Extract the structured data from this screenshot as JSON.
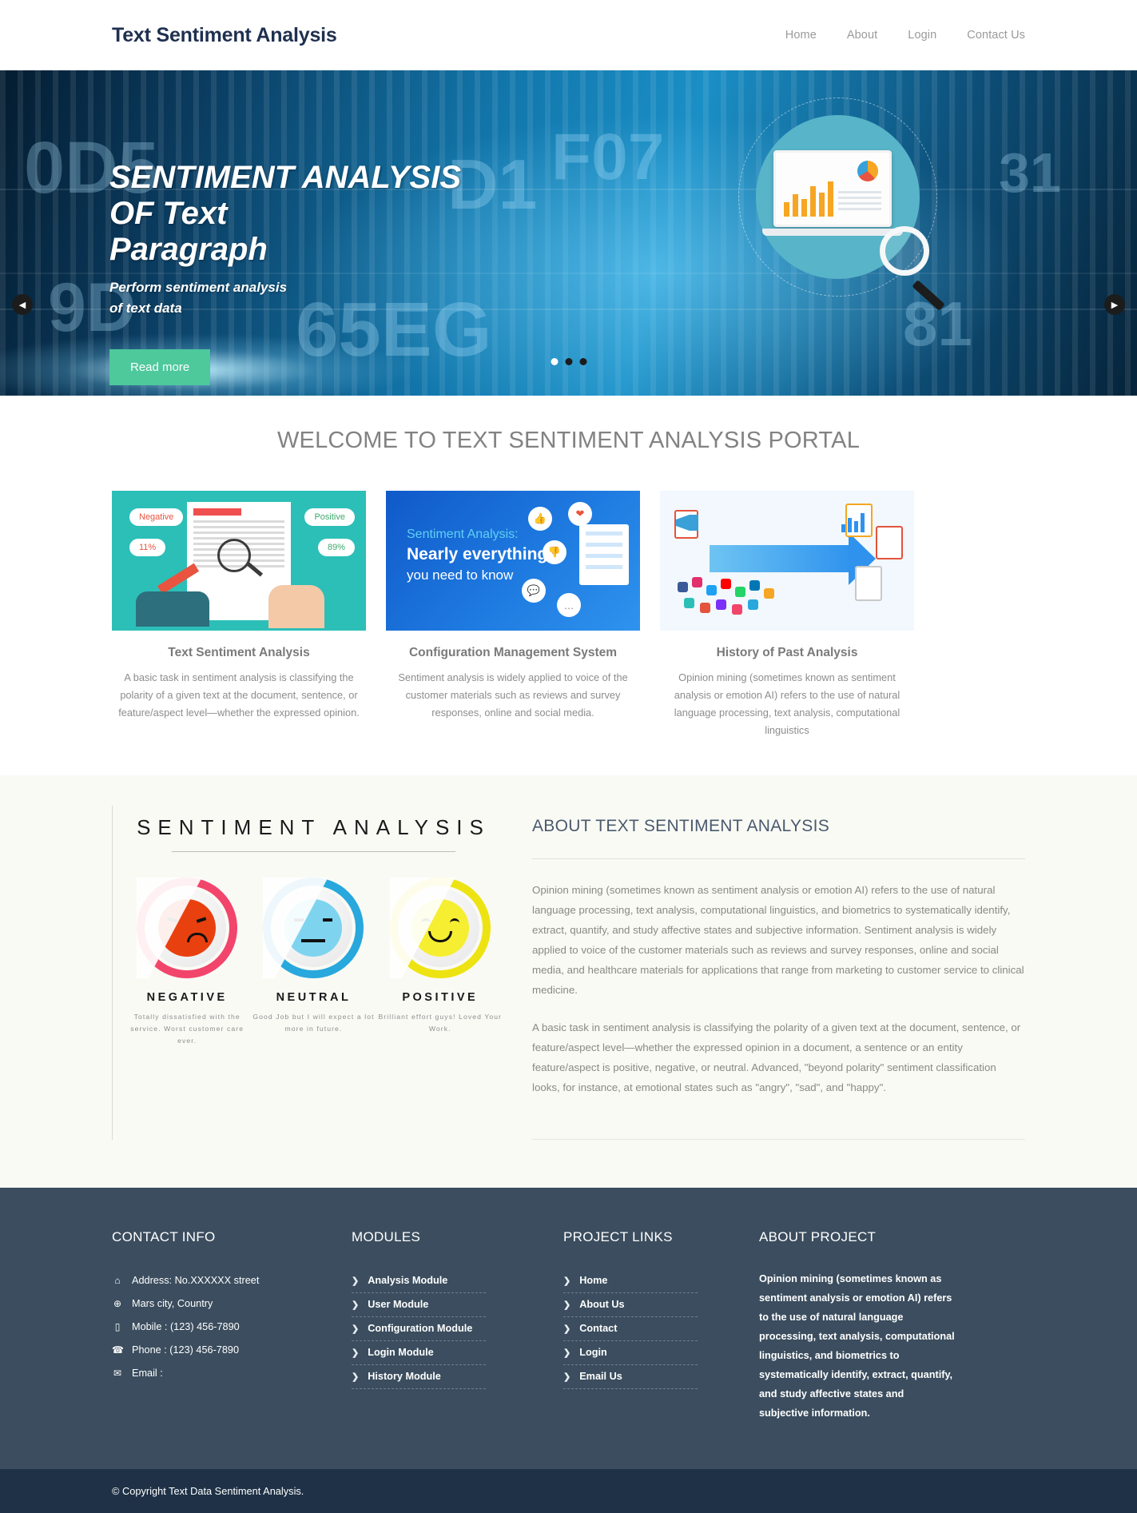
{
  "header": {
    "brand": "Text Sentiment Analysis",
    "nav": [
      {
        "label": "Home"
      },
      {
        "label": "About"
      },
      {
        "label": "Login"
      },
      {
        "label": "Contact Us"
      }
    ]
  },
  "hero": {
    "title_line1": "SENTIMENT ANALYSIS",
    "title_line2": "OF Text",
    "title_line3": "Paragraph",
    "subtitle_line1": "Perform sentiment analysis",
    "subtitle_line2": "of text data",
    "button": "Read more",
    "prev_icon": "chevron-left-icon",
    "next_icon": "chevron-right-icon",
    "dots": 3,
    "active_dot": 1,
    "bg_digits": [
      "0D5",
      "D1",
      "F07",
      "65EG",
      "81",
      "31",
      "9D"
    ],
    "accent": "#4dc99c"
  },
  "welcome": {
    "title": "WELCOME TO TEXT SENTIMENT ANALYSIS PORTAL",
    "cards": [
      {
        "title": "Text Sentiment Analysis",
        "desc": "A basic task in sentiment analysis is classifying the polarity of a given text at the document, sentence, or feature/aspect level—whether the expressed opinion.",
        "art_labels": {
          "negative": "Negative",
          "positive": "Positive",
          "neg_pct": "11%",
          "pos_pct": "89%"
        }
      },
      {
        "title": "Configuration Management System",
        "desc": "Sentiment analysis is widely applied to voice of the customer materials such as reviews and survey responses, online and social media.",
        "art_labels": {
          "line1": "Sentiment Analysis:",
          "line2": "Nearly everything",
          "line3": "you need to know"
        }
      },
      {
        "title": "History of Past Analysis",
        "desc": "Opinion mining (sometimes known as sentiment analysis or emotion AI) refers to the use of natural language processing, text analysis, computational linguistics",
        "art_labels": {}
      }
    ]
  },
  "about": {
    "graphic": {
      "title": "SENTIMENT ANALYSIS",
      "columns": [
        {
          "label": "NEGATIVE",
          "note": "Totally dissatisfied with the service. Worst customer care ever.",
          "ring_color": "#f2456b",
          "face_color": "#e8400f"
        },
        {
          "label": "NEUTRAL",
          "note": "Good Job but I will expect a lot more in future.",
          "ring_color": "#28a8dd",
          "face_color": "#7ed4ef"
        },
        {
          "label": "POSITIVE",
          "note": "Brilliant effort guys! Loved Your Work.",
          "ring_color": "#eee312",
          "face_color": "#f6ee31"
        }
      ]
    },
    "heading": "ABOUT TEXT SENTIMENT ANALYSIS",
    "paragraph1": "Opinion mining (sometimes known as sentiment analysis or emotion AI) refers to the use of natural language processing, text analysis, computational linguistics, and biometrics to systematically identify, extract, quantify, and study affective states and subjective information. Sentiment analysis is widely applied to voice of the customer materials such as reviews and survey responses, online and social media, and healthcare materials for applications that range from marketing to customer service to clinical medicine.",
    "paragraph2": "A basic task in sentiment analysis is classifying the polarity of a given text at the document, sentence, or feature/aspect level—whether the expressed opinion in a document, a sentence or an entity feature/aspect is positive, negative, or neutral. Advanced, \"beyond polarity\" sentiment classification looks, for instance, at emotional states such as \"angry\", \"sad\", and \"happy\"."
  },
  "footer": {
    "contact": {
      "heading": "CONTACT INFO",
      "items": [
        {
          "icon": "home-icon",
          "glyph": "⌂",
          "text": "Address: No.XXXXXX street"
        },
        {
          "icon": "globe-icon",
          "glyph": "⊕",
          "text": "Mars city, Country"
        },
        {
          "icon": "mobile-icon",
          "glyph": "▯",
          "text": "Mobile : (123) 456-7890"
        },
        {
          "icon": "phone-icon",
          "glyph": "☎",
          "text": "Phone : (123) 456-7890"
        },
        {
          "icon": "envelope-icon",
          "glyph": "✉",
          "text": "Email :"
        }
      ]
    },
    "modules": {
      "heading": "MODULES",
      "items": [
        "Analysis Module",
        "User Module",
        "Configuration Module",
        "Login Module",
        "History Module"
      ]
    },
    "project_links": {
      "heading": "PROJECT LINKS",
      "items": [
        "Home",
        "About Us",
        "Contact",
        "Login",
        "Email Us"
      ]
    },
    "about_project": {
      "heading": "ABOUT PROJECT",
      "text": "Opinion mining (sometimes known as sentiment analysis or emotion AI) refers to the use of natural language processing, text analysis, computational linguistics, and biometrics to systematically identify, extract, quantify, and study affective states and subjective information."
    },
    "chevron": "❯",
    "copyright": "© Copyright Text Data Sentiment Analysis.",
    "bg": "#3b4d5e",
    "bar_bg": "#1e3146"
  }
}
